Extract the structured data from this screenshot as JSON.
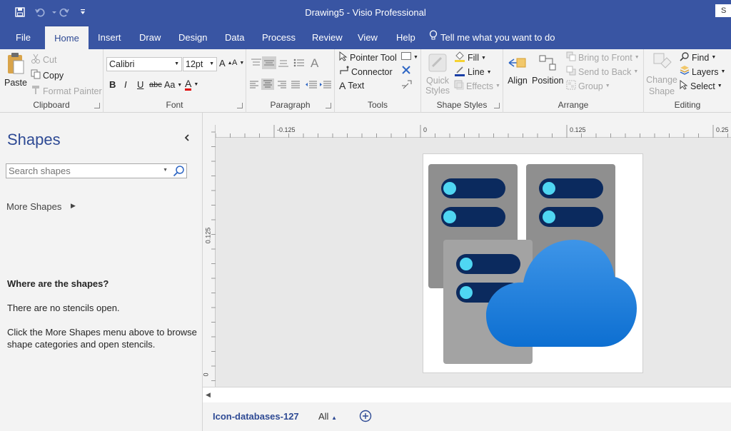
{
  "window": {
    "title": "Drawing5 - Visio Professional",
    "signin_initial": "S"
  },
  "tabs": [
    {
      "label": "File"
    },
    {
      "label": "Home"
    },
    {
      "label": "Insert"
    },
    {
      "label": "Draw"
    },
    {
      "label": "Design"
    },
    {
      "label": "Data"
    },
    {
      "label": "Process"
    },
    {
      "label": "Review"
    },
    {
      "label": "View"
    },
    {
      "label": "Help"
    }
  ],
  "tell_me": "Tell me what you want to do",
  "ribbon": {
    "clipboard": {
      "label": "Clipboard",
      "paste": "Paste",
      "cut": "Cut",
      "copy": "Copy",
      "format_painter": "Format Painter"
    },
    "font": {
      "label": "Font",
      "font_name": "Calibri",
      "font_size": "12pt",
      "bold": "B",
      "italic": "I",
      "underline": "U",
      "strike": "abc",
      "case": "Aa",
      "color_letter": "A"
    },
    "paragraph": {
      "label": "Paragraph"
    },
    "tools": {
      "label": "Tools",
      "pointer": "Pointer Tool",
      "connector": "Connector",
      "text": "Text"
    },
    "shape_styles": {
      "label": "Shape Styles",
      "quick_styles": "Quick Styles",
      "fill": "Fill",
      "line": "Line",
      "effects": "Effects"
    },
    "arrange": {
      "label": "Arrange",
      "align": "Align",
      "position": "Position",
      "bring_front": "Bring to Front",
      "send_back": "Send to Back",
      "group": "Group"
    },
    "editing": {
      "label": "Editing",
      "change_shape": "Change Shape",
      "find": "Find",
      "layers": "Layers",
      "select": "Select"
    }
  },
  "shapes_pane": {
    "title": "Shapes",
    "search_placeholder": "Search shapes",
    "more_shapes": "More Shapes",
    "where_heading": "Where are the shapes?",
    "no_stencils": "There are no stencils open.",
    "hint_line1": "Click the More Shapes menu above to browse",
    "hint_line2": "shape categories and open stencils."
  },
  "rulers": {
    "h_labels": [
      "-0.125",
      "0",
      "0.125",
      "0.25"
    ],
    "v_labels": [
      "0.125",
      "0"
    ]
  },
  "page_tabs": {
    "current": "Icon-databases-127",
    "all": "All"
  },
  "colors": {
    "accent": "#3955a3",
    "server_body": "#8f8f8f",
    "server_slot": "#0b2a5e",
    "server_led": "#4fd6f2",
    "cloud_top": "#3e95e8",
    "cloud_bottom": "#0d6fd1"
  }
}
